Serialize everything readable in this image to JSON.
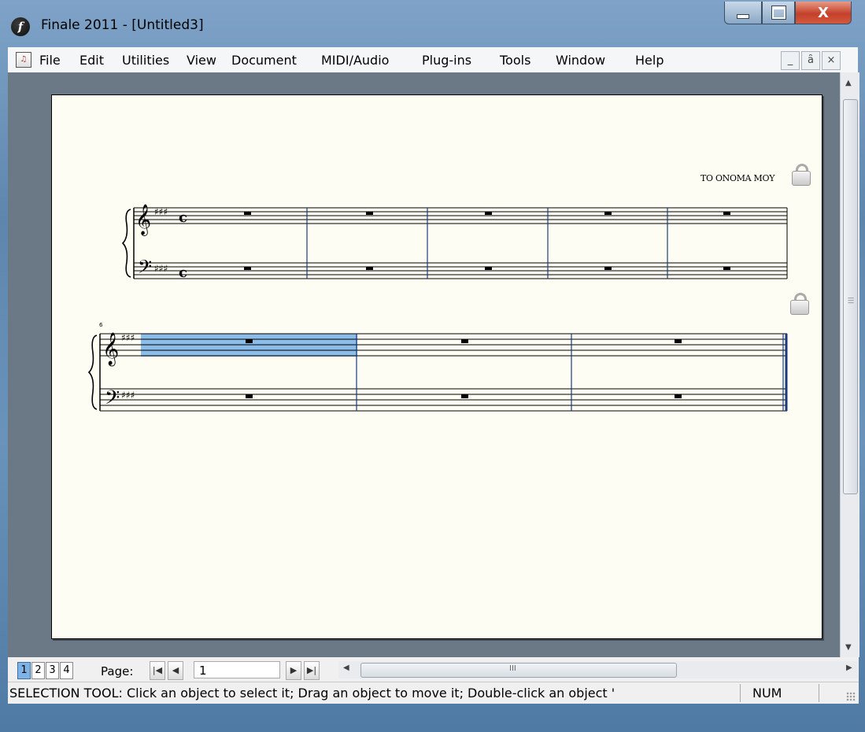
{
  "window": {
    "title": "Finale 2011 - [Untitled3]",
    "icon": "finale-f-icon",
    "close_glyph": "X"
  },
  "menu": {
    "items": [
      "File",
      "Edit",
      "Utilities",
      "View",
      "Document",
      "MIDI/Audio",
      "Plug-ins",
      "Tools",
      "Window",
      "Help"
    ],
    "mdi_buttons": [
      "_",
      "ȃ",
      "×"
    ]
  },
  "score": {
    "title_text": "TO ONOMA MOY",
    "measure_number": "6",
    "time_signature": "c",
    "selection_color": "#8cbce8"
  },
  "bottom": {
    "page_buttons": [
      "1",
      "2",
      "3",
      "4"
    ],
    "active_page": "1",
    "page_label": "Page:",
    "page_value": "1",
    "hscroll_grip": "III"
  },
  "status": {
    "message": "SELECTION TOOL: Click an object to select it; Drag an object to move it; Double-click an object '",
    "num": "NUM"
  }
}
